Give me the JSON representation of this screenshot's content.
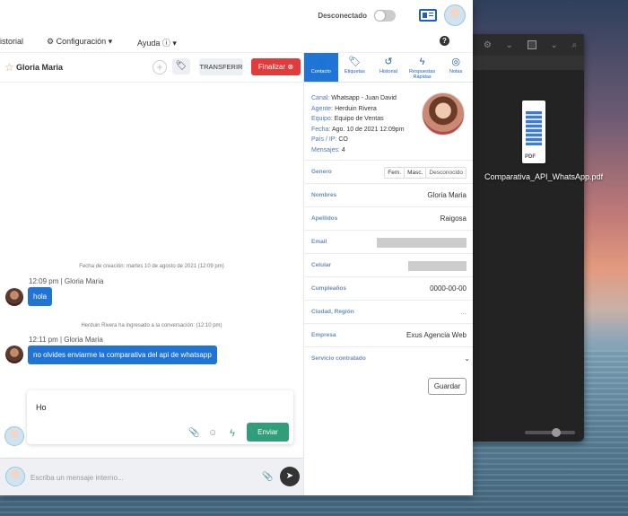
{
  "topbar": {
    "status": "Desconectado"
  },
  "menu": {
    "historial": "istorial",
    "config": "⚙ Configuración",
    "config_chevron": "▾",
    "ayuda": "Ayuda ⓘ",
    "ayuda_chevron": "▾",
    "help": "?"
  },
  "chat": {
    "contact_name": "Gloria Maria",
    "transfer_label": "TRANSFERIR",
    "finalize_label": "Finalizar ⊗",
    "created_note": "Fecha de creación: martes 10 de agosto de 2021 (12:09 pm)",
    "joined_note": "Herduin Rivera ha ingresado a la conversación: (12:10 pm)",
    "messages": [
      {
        "meta": "12:09 pm | Gloria Maria",
        "text": "hola"
      },
      {
        "meta": "12:11 pm | Gloria Maria",
        "text": "no olvides enviarme la comparativa del api de whatsapp"
      }
    ],
    "composer_text": "Ho",
    "send_label": "Enviar",
    "internal_placeholder": "Escriba un mensaje interno..."
  },
  "info": {
    "tabs": [
      {
        "label": "Contacto",
        "glyph": "👤"
      },
      {
        "label": "Etiquetas",
        "glyph": "🏷"
      },
      {
        "label": "Historial",
        "glyph": "↺"
      },
      {
        "label": "Respuestas Rápidas",
        "glyph": "ϟ"
      },
      {
        "label": "Notas",
        "glyph": "◎"
      }
    ],
    "details": [
      {
        "k": "Canal:",
        "v": "Whatsapp - Juan David"
      },
      {
        "k": "Agente:",
        "v": "Herduin Rivera"
      },
      {
        "k": "Equipo:",
        "v": "Equipo de Ventas"
      },
      {
        "k": "Fecha:",
        "v": "Ago. 10 de 2021 12:09pm"
      },
      {
        "k": "País / IP:",
        "v": "CO"
      },
      {
        "k": "Mensajes:",
        "v": "4"
      }
    ],
    "fields": {
      "genero": "Genero",
      "gender_options": [
        "Fem.",
        "Masc.",
        "Desconocido"
      ],
      "nombres": "Nombres",
      "nombres_val": "Gloria Maria",
      "apellidos": "Apellidos",
      "apellidos_val": "Raigosa",
      "email": "Email",
      "celular": "Celular",
      "cumple": "Cumpleaños",
      "cumple_val": "0000-00-00",
      "ciudad": "Ciudad, Región",
      "ciudad_val": "...",
      "empresa": "Empresa",
      "empresa_val": "Exus Agencia Web",
      "servicio": "Servicio contratado"
    },
    "save_label": "Guardar"
  },
  "desktop": {
    "file_name": "Comparativa_API_WhatsApp.pdf",
    "pdf_tag": "PDF"
  }
}
